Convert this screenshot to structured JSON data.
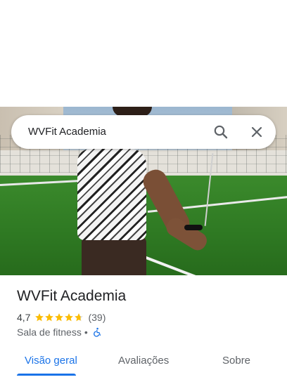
{
  "search": {
    "query": "WVFit Academia"
  },
  "place": {
    "title": "WVFit Academia",
    "rating": "4,7",
    "rating_value": 4.7,
    "review_count": "(39)",
    "category": "Sala de fitness",
    "separator": "•",
    "accessibility_icon": "wheelchair-icon"
  },
  "tabs": [
    {
      "label": "Visão geral",
      "active": true
    },
    {
      "label": "Avaliações",
      "active": false
    },
    {
      "label": "Sobre",
      "active": false
    }
  ],
  "colors": {
    "accent": "#1a73e8",
    "star": "#fbbc04",
    "text_primary": "#202124",
    "text_secondary": "#5f6368"
  }
}
